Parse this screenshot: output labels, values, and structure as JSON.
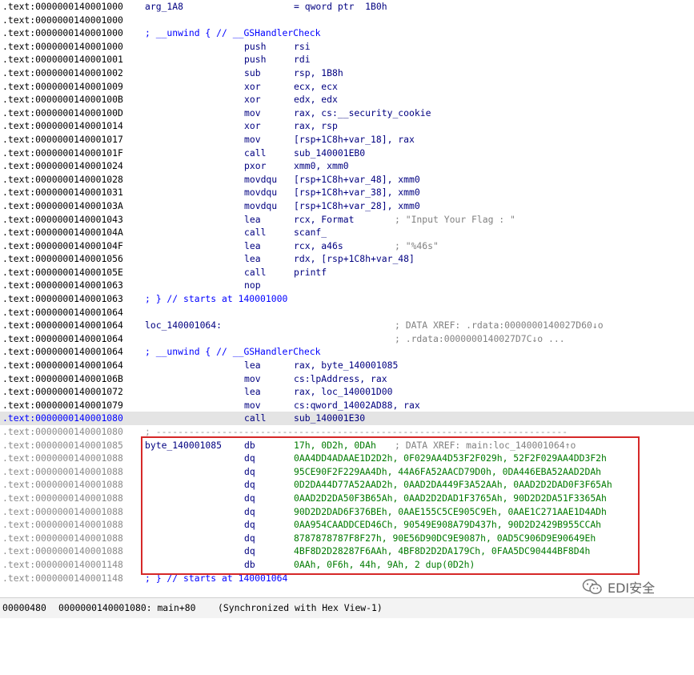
{
  "listing": [
    {
      "addr": ".text:0000000140001000",
      "label": "arg_1A8",
      "ops": "= qword ptr  1B0h"
    },
    {
      "addr": ".text:0000000140001000"
    },
    {
      "addr": ".text:0000000140001000",
      "note": "; __unwind { // __GSHandlerCheck"
    },
    {
      "addr": ".text:0000000140001000",
      "mnem": "push",
      "ops": "rsi"
    },
    {
      "addr": ".text:0000000140001001",
      "mnem": "push",
      "ops": "rdi"
    },
    {
      "addr": ".text:0000000140001002",
      "mnem": "sub",
      "ops": "rsp, 1B8h"
    },
    {
      "addr": ".text:0000000140001009",
      "mnem": "xor",
      "ops": "ecx, ecx"
    },
    {
      "addr": ".text:000000014000100B",
      "mnem": "xor",
      "ops": "edx, edx"
    },
    {
      "addr": ".text:000000014000100D",
      "mnem": "mov",
      "ops": "rax, cs:__security_cookie"
    },
    {
      "addr": ".text:0000000140001014",
      "mnem": "xor",
      "ops": "rax, rsp"
    },
    {
      "addr": ".text:0000000140001017",
      "mnem": "mov",
      "ops": "[rsp+1C8h+var_18], rax"
    },
    {
      "addr": ".text:000000014000101F",
      "mnem": "call",
      "ops": "sub_140001EB0"
    },
    {
      "addr": ".text:0000000140001024",
      "mnem": "pxor",
      "ops": "xmm0, xmm0"
    },
    {
      "addr": ".text:0000000140001028",
      "mnem": "movdqu",
      "ops": "[rsp+1C8h+var_48], xmm0"
    },
    {
      "addr": ".text:0000000140001031",
      "mnem": "movdqu",
      "ops": "[rsp+1C8h+var_38], xmm0"
    },
    {
      "addr": ".text:000000014000103A",
      "mnem": "movdqu",
      "ops": "[rsp+1C8h+var_28], xmm0"
    },
    {
      "addr": ".text:0000000140001043",
      "mnem": "lea",
      "ops": "rcx, Format",
      "cmt": "; \"Input Your Flag : \""
    },
    {
      "addr": ".text:000000014000104A",
      "mnem": "call",
      "ops": "scanf_"
    },
    {
      "addr": ".text:000000014000104F",
      "mnem": "lea",
      "ops": "rcx, a46s",
      "cmt": "; \"%46s\""
    },
    {
      "addr": ".text:0000000140001056",
      "mnem": "lea",
      "ops": "rdx, [rsp+1C8h+var_48]"
    },
    {
      "addr": ".text:000000014000105E",
      "mnem": "call",
      "ops": "printf"
    },
    {
      "addr": ".text:0000000140001063",
      "mnem": "nop",
      "ops": ""
    },
    {
      "addr": ".text:0000000140001063",
      "note": "; } // starts at 140001000"
    },
    {
      "addr": ".text:0000000140001064"
    },
    {
      "addr": ".text:0000000140001064",
      "label": "loc_140001064:",
      "cmt": "; DATA XREF: .rdata:0000000140027D60↓o"
    },
    {
      "addr": ".text:0000000140001064",
      "cmt": "; .rdata:0000000140027D7C↓o ..."
    },
    {
      "addr": ".text:0000000140001064",
      "note": "; __unwind { // __GSHandlerCheck"
    },
    {
      "addr": ".text:0000000140001064",
      "mnem": "lea",
      "ops": "rax, byte_140001085"
    },
    {
      "addr": ".text:000000014000106B",
      "mnem": "mov",
      "ops": "cs:lpAddress, rax"
    },
    {
      "addr": ".text:0000000140001072",
      "mnem": "lea",
      "ops": "rax, loc_140001D00"
    },
    {
      "addr": ".text:0000000140001079",
      "mnem": "mov",
      "ops": "cs:qword_14002AD88, rax"
    },
    {
      "addr": ".text:0000000140001080",
      "mnem": "call",
      "ops": "sub_140001E30",
      "selected": true
    },
    {
      "addr": ".text:0000000140001080",
      "sep": "; ---------------------------------------------------------------------------"
    },
    {
      "addr": ".text:0000000140001085",
      "label": "byte_140001085",
      "mnem": "db",
      "ops": "17h, 0D2h, 0DAh",
      "cmt": "; DATA XREF: main:loc_140001064↑o",
      "data": true
    },
    {
      "addr": ".text:0000000140001088",
      "mnem": "dq",
      "ops": "0AA4DD4ADAAE1D2D2h, 0F029AA4D53F2F029h, 52F2F029AA4DD3F2h",
      "data": true
    },
    {
      "addr": ".text:0000000140001088",
      "mnem": "dq",
      "ops": "95CE90F2F229AA4Dh, 44A6FA52AACD79D0h, 0DA446EBA52AAD2DAh",
      "data": true
    },
    {
      "addr": ".text:0000000140001088",
      "mnem": "dq",
      "ops": "0D2DA44D77A52AAD2h, 0AAD2DA449F3A52AAh, 0AAD2D2DAD0F3F65Ah",
      "data": true
    },
    {
      "addr": ".text:0000000140001088",
      "mnem": "dq",
      "ops": "0AAD2D2DA50F3B65Ah, 0AAD2D2DAD1F3765Ah, 90D2D2DA51F3365Ah",
      "data": true
    },
    {
      "addr": ".text:0000000140001088",
      "mnem": "dq",
      "ops": "90D2D2DAD6F376BEh, 0AAE155C5CE905C9Eh, 0AAE1C271AAE1D4ADh",
      "data": true
    },
    {
      "addr": ".text:0000000140001088",
      "mnem": "dq",
      "ops": "0AA954CAADDCED46Ch, 90549E908A79D437h, 90D2D2429B955CCAh",
      "data": true
    },
    {
      "addr": ".text:0000000140001088",
      "mnem": "dq",
      "ops": "8787878787F8F27h, 90E56D90DC9E9087h, 0AD5C906D9E90649Eh",
      "data": true
    },
    {
      "addr": ".text:0000000140001088",
      "mnem": "dq",
      "ops": "4BF8D2D28287F6AAh, 4BF8D2D2DA179Ch, 0FAA5DC90444BF8D4h",
      "data": true
    },
    {
      "addr": ".text:0000000140001148",
      "mnem": "db",
      "ops": "0AAh, 0F6h, 44h, 9Ah, 2 dup(0D2h)",
      "data": true
    },
    {
      "addr": ".text:0000000140001148",
      "note": "; } // starts at 140001064",
      "data": true
    }
  ],
  "status": {
    "offset": "00000480",
    "location": "0000000140001080: main+80",
    "sync": "(Synchronized with Hex View-1)"
  },
  "watermark": {
    "text": "EDI安全",
    "icon": "wechat-icon"
  }
}
